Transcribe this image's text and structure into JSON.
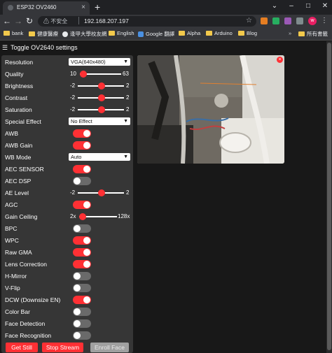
{
  "browser": {
    "tab_title": "ESP32 OV2460",
    "not_secure": "不安全",
    "url": "192.168.207.197",
    "bookmarks": [
      "bank",
      "健康醫療",
      "逢甲大學校友網",
      "English",
      "Google 翻譯",
      "Alpha",
      "Arduino",
      "Blog"
    ],
    "all_bookmarks": "所有書籤",
    "profile_initial": "w"
  },
  "header": {
    "toggle_label": "Toggle OV2640 settings"
  },
  "settings": {
    "resolution": {
      "label": "Resolution",
      "value": "VGA(640x480)"
    },
    "quality": {
      "label": "Quality",
      "min": "10",
      "max": "63",
      "value": 14
    },
    "brightness": {
      "label": "Brightness",
      "min": "-2",
      "max": "2",
      "value": 0
    },
    "contrast": {
      "label": "Contrast",
      "min": "-2",
      "max": "2",
      "value": 0
    },
    "saturation": {
      "label": "Saturation",
      "min": "-2",
      "max": "2",
      "value": 0
    },
    "special_effect": {
      "label": "Special Effect",
      "value": "No Effect"
    },
    "awb": {
      "label": "AWB",
      "on": true
    },
    "awb_gain": {
      "label": "AWB Gain",
      "on": true
    },
    "wb_mode": {
      "label": "WB Mode",
      "value": "Auto"
    },
    "aec_sensor": {
      "label": "AEC SENSOR",
      "on": true
    },
    "aec_dsp": {
      "label": "AEC DSP",
      "on": false
    },
    "ae_level": {
      "label": "AE Level",
      "min": "-2",
      "max": "2",
      "value": 0
    },
    "agc": {
      "label": "AGC",
      "on": true
    },
    "gain_ceiling": {
      "label": "Gain Ceiling",
      "min": "2x",
      "max": "128x",
      "value": 0
    },
    "bpc": {
      "label": "BPC",
      "on": false
    },
    "wpc": {
      "label": "WPC",
      "on": true
    },
    "raw_gma": {
      "label": "Raw GMA",
      "on": true
    },
    "lens_correction": {
      "label": "Lens Correction",
      "on": true
    },
    "h_mirror": {
      "label": "H-Mirror",
      "on": false
    },
    "v_flip": {
      "label": "V-Flip",
      "on": false
    },
    "dcw": {
      "label": "DCW (Downsize EN)",
      "on": true
    },
    "color_bar": {
      "label": "Color Bar",
      "on": false
    },
    "face_detection": {
      "label": "Face Detection",
      "on": false
    },
    "face_recognition": {
      "label": "Face Recognition",
      "on": false
    }
  },
  "buttons": {
    "get_still": "Get Still",
    "stop_stream": "Stop Stream",
    "enroll_face": "Enroll Face"
  },
  "colors": {
    "accent": "#ff3034",
    "panel": "#363636",
    "background": "#181818"
  },
  "stream": {
    "close_icon": "×"
  }
}
